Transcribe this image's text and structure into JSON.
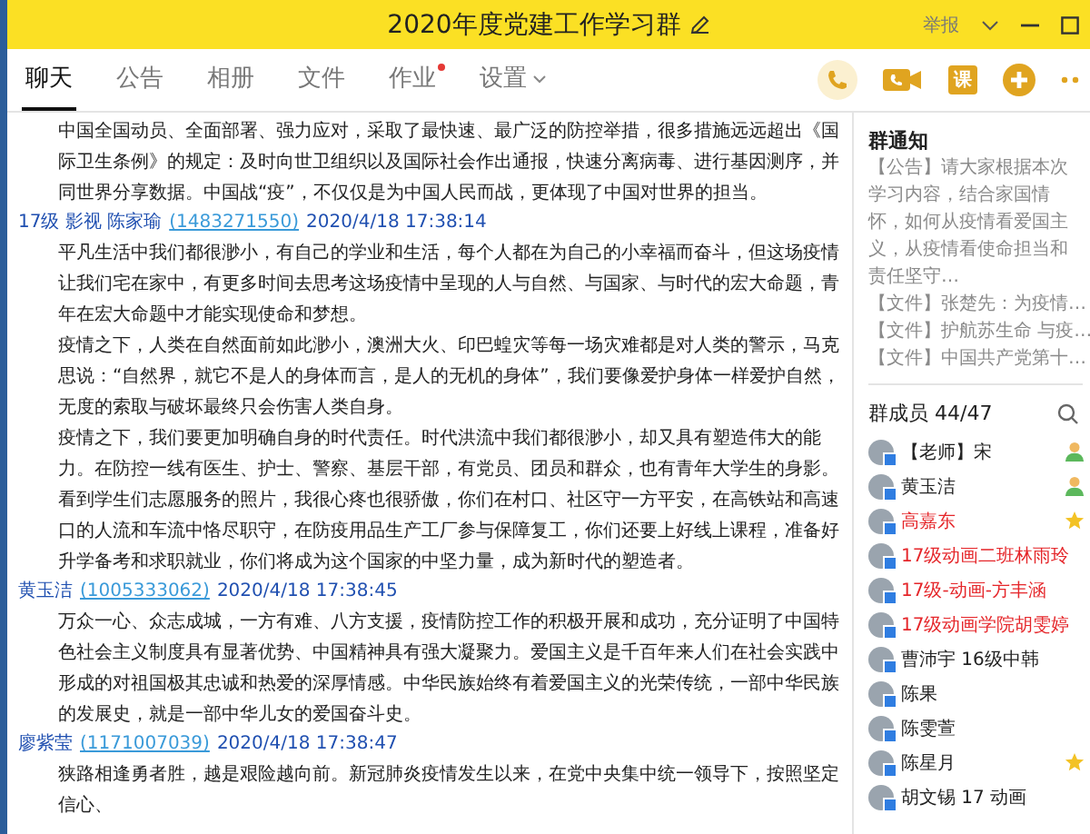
{
  "window": {
    "title": "2020年度党建工作学习群",
    "report": "举报"
  },
  "tabs": [
    {
      "label": "聊天",
      "selected": true,
      "dot": false,
      "menu": false
    },
    {
      "label": "公告",
      "selected": false,
      "dot": false,
      "menu": false
    },
    {
      "label": "相册",
      "selected": false,
      "dot": false,
      "menu": false
    },
    {
      "label": "文件",
      "selected": false,
      "dot": false,
      "menu": false
    },
    {
      "label": "作业",
      "selected": false,
      "dot": true,
      "menu": false
    },
    {
      "label": "设置",
      "selected": false,
      "dot": false,
      "menu": true
    }
  ],
  "toolbar": [
    {
      "kind": "phone"
    },
    {
      "kind": "video"
    },
    {
      "kind": "course",
      "label": "课"
    },
    {
      "kind": "plus"
    },
    {
      "kind": "more"
    }
  ],
  "messages": [
    {
      "paragraphs": [
        "中国全国动员、全面部署、强力应对，采取了最快速、最广泛的防控举措，很多措施远远超出《国际卫生条例》的规定：及时向世卫组织以及国际社会作出通报，快速分离病毒、进行基因测序，并同世界分享数据。中国战“疫”，不仅仅是为中国人民而战，更体现了中国对世界的担当。"
      ]
    },
    {
      "sender": "17级 影视 陈家瑜",
      "qq": "(1483271550)",
      "time": "2020/4/18 17:38:14",
      "paragraphs": [
        "平凡生活中我们都很渺小，有自己的学业和生活，每个人都在为自己的小幸福而奋斗，但这场疫情让我们宅在家中，有更多时间去思考这场疫情中呈现的人与自然、与国家、与时代的宏大命题，青年在宏大命题中才能实现使命和梦想。",
        "疫情之下，人类在自然面前如此渺小，澳洲大火、印巴蝗灾等每一场灾难都是对人类的警示，马克思说：“自然界，就它不是人的身体而言，是人的无机的身体”，我们要像爱护身体一样爱护自然，无度的索取与破坏最终只会伤害人类自身。",
        "疫情之下，我们要更加明确自身的时代责任。时代洪流中我们都很渺小，却又具有塑造伟大的能力。在防控一线有医生、护士、警察、基层干部，有党员、团员和群众，也有青年大学生的身影。看到学生们志愿服务的照片，我很心疼也很骄傲，你们在村口、社区守一方平安，在高铁站和高速口的人流和车流中恪尽职守，在防疫用品生产工厂参与保障复工，你们还要上好线上课程，准备好升学备考和求职就业，你们将成为这个国家的中坚力量，成为新时代的塑造者。"
      ]
    },
    {
      "sender": "黄玉洁",
      "qq": "(1005333062)",
      "time": "2020/4/18 17:38:45",
      "paragraphs": [
        "万众一心、众志成城，一方有难、八方支援，疫情防控工作的积极开展和成功，充分证明了中国特色社会主义制度具有显著优势、中国精神具有强大凝聚力。爱国主义是千百年来人们在社会实践中形成的对祖国极其忠诚和热爱的深厚情感。中华民族始终有着爱国主义的光荣传统，一部中华民族的发展史，就是一部中华儿女的爱国奋斗史。"
      ]
    },
    {
      "sender": "廖紫莹",
      "qq": "(1171007039)",
      "time": "2020/4/18 17:38:47",
      "paragraphs": [
        "狭路相逢勇者胜，越是艰险越向前。新冠肺炎疫情发生以来，在党中央集中统一领导下，按照坚定信心、"
      ]
    }
  ],
  "notice": {
    "title": "群通知",
    "text": "【公告】请大家根据本次学习内容，结合家国情怀，如何从疫情看爱国主义，从疫情看使命担当和责任坚守…",
    "files": [
      "【文件】张楚先：为疫情…",
      "【文件】护航苏生命 与疫…",
      "【文件】中国共产党第十…"
    ]
  },
  "members": {
    "title": "群成员 44/47",
    "items": [
      {
        "name": "【老师】宋",
        "color": "#222222",
        "kind": "person"
      },
      {
        "name": "黄玉洁",
        "color": "#222222",
        "kind": "person"
      },
      {
        "name": "高嘉东",
        "color": "#e5262a",
        "kind": "star"
      },
      {
        "name": "17级动画二班林雨玲",
        "color": "#e5262a",
        "kind": "plain"
      },
      {
        "name": "17级-动画-方丰涵",
        "color": "#e5262a",
        "kind": "plain"
      },
      {
        "name": "17级动画学院胡雯婷",
        "color": "#e5262a",
        "kind": "plain"
      },
      {
        "name": "曹沛宇 16级中韩",
        "color": "#222222",
        "kind": "plain"
      },
      {
        "name": "陈果",
        "color": "#222222",
        "kind": "plain"
      },
      {
        "name": "陈雯萱",
        "color": "#222222",
        "kind": "plain"
      },
      {
        "name": "陈星月",
        "color": "#222222",
        "kind": "star"
      },
      {
        "name": "胡文锡 17 动画",
        "color": "#222222",
        "kind": "plain"
      }
    ]
  }
}
